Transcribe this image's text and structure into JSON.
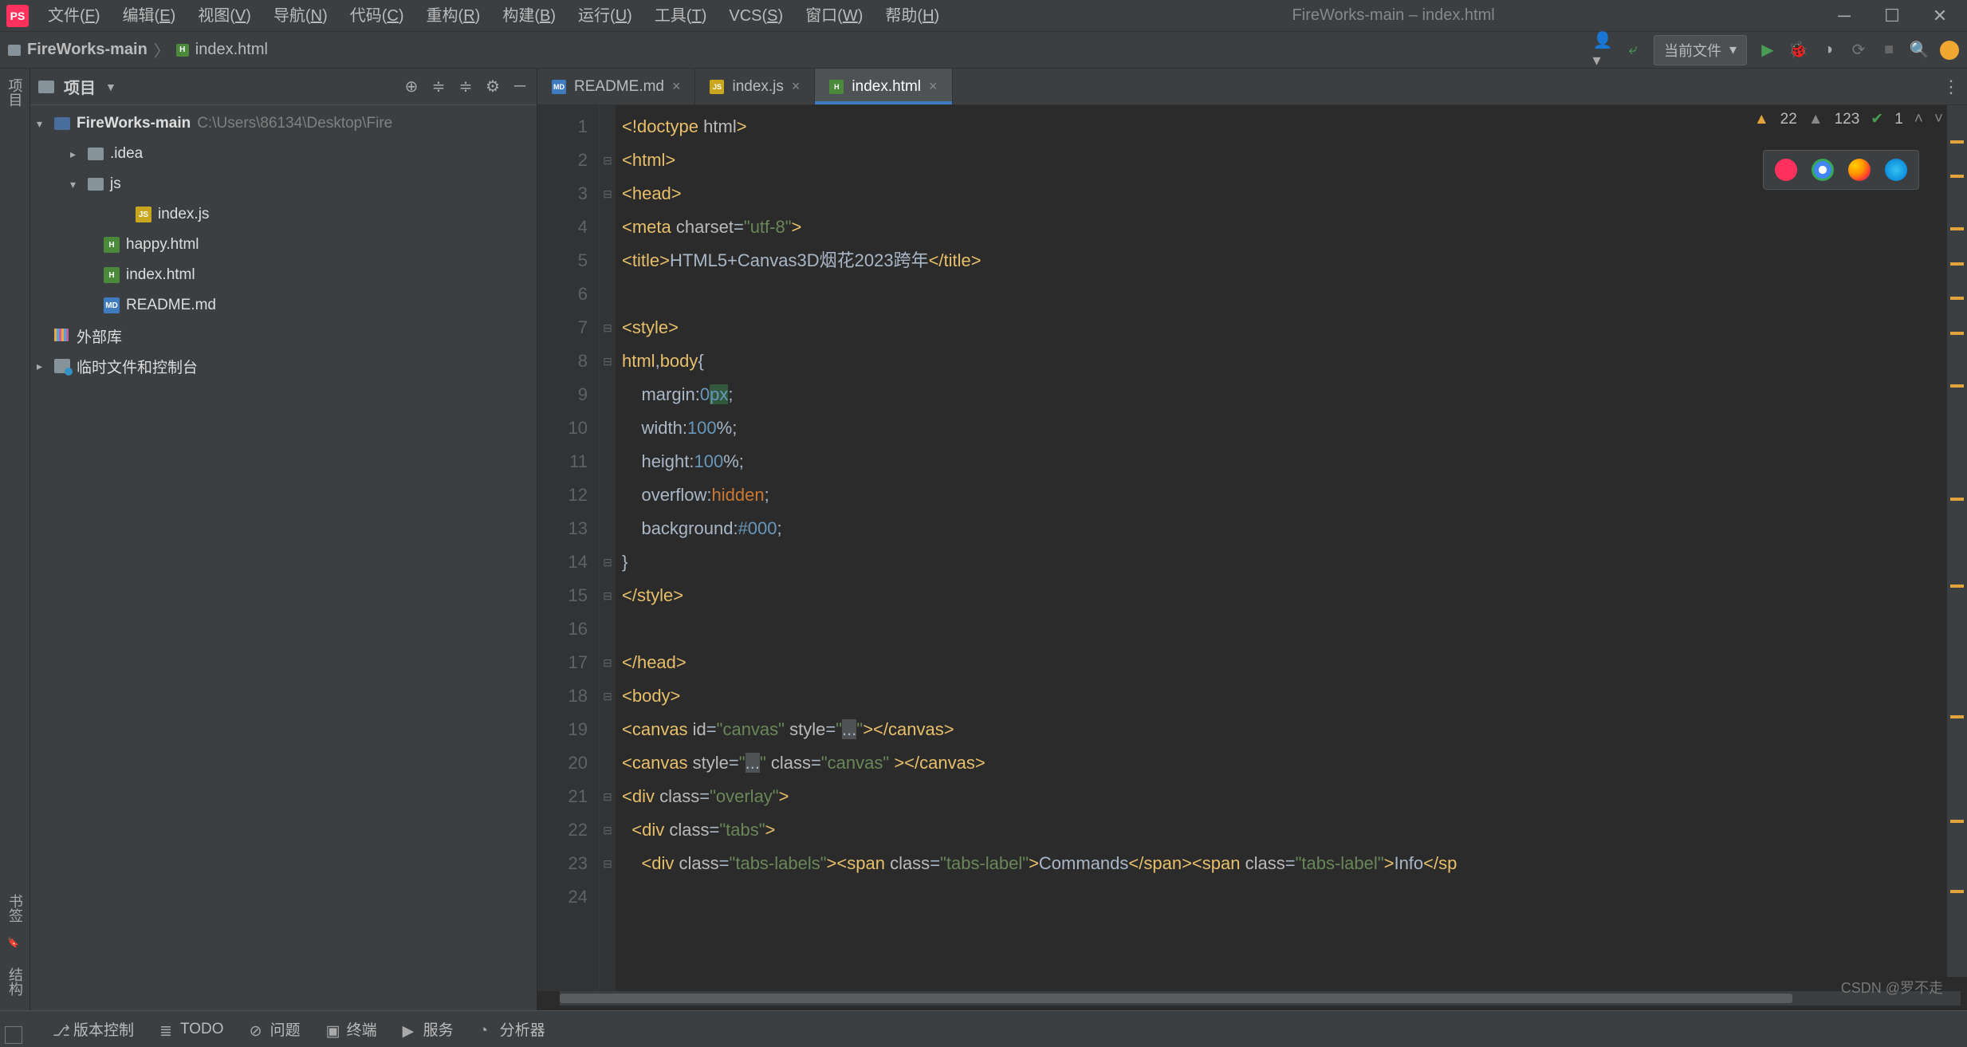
{
  "menubar": {
    "items": [
      "文件(F)",
      "编辑(E)",
      "视图(V)",
      "导航(N)",
      "代码(C)",
      "重构(R)",
      "构建(B)",
      "运行(U)",
      "工具(T)",
      "VCS(S)",
      "窗口(W)",
      "帮助(H)"
    ],
    "window_title": "FireWorks-main – index.html"
  },
  "breadcrumb": {
    "project": "FireWorks-main",
    "file": "index.html"
  },
  "toolbar": {
    "run_config": "当前文件"
  },
  "project_panel": {
    "title": "项目",
    "tree": {
      "root": {
        "name": "FireWorks-main",
        "path": "C:\\Users\\86134\\Desktop\\Fire"
      },
      "idea": ".idea",
      "js_folder": "js",
      "index_js": "index.js",
      "happy_html": "happy.html",
      "index_html": "index.html",
      "readme": "README.md",
      "ext_lib": "外部库",
      "scratch": "临时文件和控制台"
    }
  },
  "tabs": [
    {
      "icon": "md",
      "label": "README.md",
      "active": false
    },
    {
      "icon": "js",
      "label": "index.js",
      "active": false
    },
    {
      "icon": "html",
      "label": "index.html",
      "active": true
    }
  ],
  "inspection": {
    "warnings": "22",
    "weak": "123",
    "ok": "1"
  },
  "code": {
    "lines": [
      {
        "n": 1,
        "html": "<span class='tk-tag'>&lt;!doctype</span> <span class='tk-attr'>html</span><span class='tk-tag'>&gt;</span>"
      },
      {
        "n": 2,
        "html": "<span class='tk-tag'>&lt;html&gt;</span>"
      },
      {
        "n": 3,
        "html": "<span class='tk-tag'>&lt;head&gt;</span>"
      },
      {
        "n": 4,
        "html": "<span class='tk-tag'>&lt;meta </span><span class='tk-attr'>charset</span>=<span class='tk-str'>\"utf-8\"</span><span class='tk-tag'>&gt;</span>"
      },
      {
        "n": 5,
        "html": "<span class='tk-tag'>&lt;title&gt;</span><span class='tk-txt'>HTML5+Canvas3D烟花2023跨年</span><span class='tk-tag'>&lt;/title&gt;</span>"
      },
      {
        "n": 6,
        "html": ""
      },
      {
        "n": 7,
        "html": "<span class='tk-tag'>&lt;style&gt;</span>"
      },
      {
        "n": 8,
        "html": "<span class='tk-sel'>html</span>,<span class='tk-sel'>body</span>{"
      },
      {
        "n": 9,
        "html": "    <span class='tk-prop'>margin</span>:<span class='tk-num'>0</span><span class='highlight-px tk-num'>px</span>;"
      },
      {
        "n": 10,
        "html": "    <span class='tk-prop'>width</span>:<span class='tk-num'>100</span>%;"
      },
      {
        "n": 11,
        "html": "    <span class='tk-prop'>height</span>:<span class='tk-num'>100</span>%;"
      },
      {
        "n": 12,
        "html": "    <span class='tk-prop'>overflow</span>:<span class='tk-kw'>hidden</span>;"
      },
      {
        "n": 13,
        "html": "    <span class='tk-prop'>background</span>:<span class='tk-num'>#000</span>;"
      },
      {
        "n": 14,
        "html": "}"
      },
      {
        "n": 15,
        "html": "<span class='tk-tag'>&lt;/style&gt;</span>"
      },
      {
        "n": 16,
        "html": ""
      },
      {
        "n": 17,
        "html": "<span class='tk-tag'>&lt;/head&gt;</span>"
      },
      {
        "n": 18,
        "html": "<span class='tk-tag'>&lt;body&gt;</span>"
      },
      {
        "n": 19,
        "html": "<span class='tk-tag'>&lt;canvas </span><span class='tk-attr'>id</span>=<span class='tk-str'>\"canvas\"</span> <span class='tk-attr'>style</span>=<span class='tk-str'>\"</span><span style='background:#4e5254'>...</span><span class='tk-str'>\"</span><span class='tk-tag'>&gt;&lt;/canvas&gt;</span>"
      },
      {
        "n": 20,
        "html": "<span class='tk-tag'>&lt;canvas </span><span class='tk-attr'>style</span>=<span class='tk-str'>\"</span><span style='background:#4e5254'>...</span><span class='tk-str'>\"</span> <span class='tk-attr'>class</span>=<span class='tk-str'>\"canvas\"</span> <span class='tk-tag'>&gt;&lt;/canvas&gt;</span>"
      },
      {
        "n": 21,
        "html": "<span class='tk-tag'>&lt;div </span><span class='tk-attr'>class</span>=<span class='tk-str'>\"overlay\"</span><span class='tk-tag'>&gt;</span>"
      },
      {
        "n": 22,
        "html": "  <span class='tk-tag'>&lt;div </span><span class='tk-attr'>class</span>=<span class='tk-str'>\"tabs\"</span><span class='tk-tag'>&gt;</span>"
      },
      {
        "n": 23,
        "html": "    <span class='tk-tag'>&lt;div </span><span class='tk-attr'>class</span>=<span class='tk-str'>\"tabs-labels\"</span><span class='tk-tag'>&gt;&lt;span </span><span class='tk-attr'>class</span>=<span class='tk-str'>\"tabs-label\"</span><span class='tk-tag'>&gt;</span>Commands<span class='tk-tag'>&lt;/span&gt;&lt;span </span><span class='tk-attr'>class</span>=<span class='tk-str'>\"tabs-label\"</span><span class='tk-tag'>&gt;</span>Info<span class='tk-tag'>&lt;/sp</span>"
      },
      {
        "n": 24,
        "html": ""
      }
    ]
  },
  "statusbar": {
    "items": [
      "版本控制",
      "TODO",
      "问题",
      "终端",
      "服务",
      "分析器"
    ]
  },
  "watermark": "CSDN @罗不走"
}
